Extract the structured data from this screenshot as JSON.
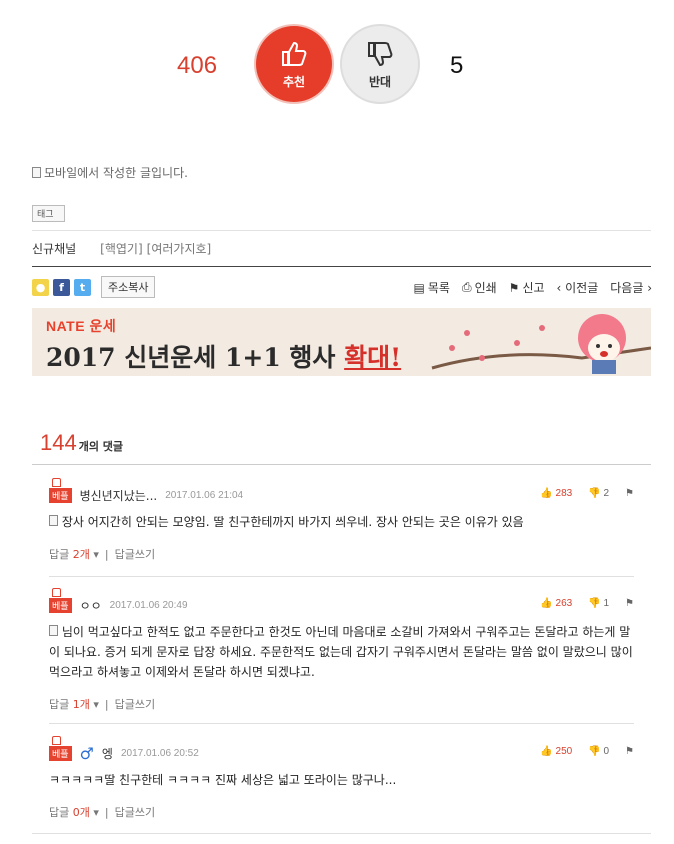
{
  "vote": {
    "up_count": "406",
    "up_label": "추천",
    "down_label": "반대",
    "down_count": "5"
  },
  "post": {
    "mobile_note": "모바일에서 작성한 글입니다.",
    "tag_label": "태그"
  },
  "channel": {
    "label": "신규채널",
    "tags": [
      "[핵엽기]",
      "[여러가지호]"
    ]
  },
  "share": {
    "copy_label": "주소복사"
  },
  "toolbar": {
    "list": "목록",
    "print": "인쇄",
    "report": "신고",
    "prev": "‹ 이전글",
    "next": "다음글 ›"
  },
  "banner": {
    "brand": "NATE 운세",
    "headline_main": "2017 신년운세 1+1 행사 ",
    "headline_red": "확대!"
  },
  "comments_header": {
    "count": "144",
    "suffix": "개의 댓글"
  },
  "comments": [
    {
      "badge": "베플",
      "author": "병신년지났는...",
      "date": "2017.01.06 21:04",
      "up": "283",
      "down": "2",
      "body": "장사 어지간히 안되는 모양임. 딸 친구한테까지 바가지 씌우네. 장사 안되는 곳은 이유가 있음",
      "reply_label": "답글",
      "reply_count": "2개",
      "write_label": "답글쓰기"
    },
    {
      "badge": "베플",
      "author": "ㅇㅇ",
      "date": "2017.01.06 20:49",
      "up": "263",
      "down": "1",
      "body": "님이 먹고싶다고 한적도 없고 주문한다고 한것도 아닌데 마음대로 소갈비 가져와서 구워주고는 돈달라고 하는게 말이 되나요. 증거 되게 문자로 답장 하세요. 주문한적도 없는데 갑자기 구워주시면서 돈달라는 말씀 없이 말랐으니 많이 먹으라고 하셔놓고 이제와서 돈달라 하시면 되겠냐고.",
      "reply_label": "답글",
      "reply_count": "1개",
      "write_label": "답글쓰기"
    },
    {
      "badge": "베플",
      "author": "엥",
      "date": "2017.01.06 20:52",
      "up": "250",
      "down": "0",
      "body": "ㅋㅋㅋㅋㅋ딸 친구한테 ㅋㅋㅋㅋ 진짜 세상은 넓고 또라이는 많구나...",
      "reply_label": "답글",
      "reply_count": "0개",
      "write_label": "답글쓰기"
    }
  ]
}
